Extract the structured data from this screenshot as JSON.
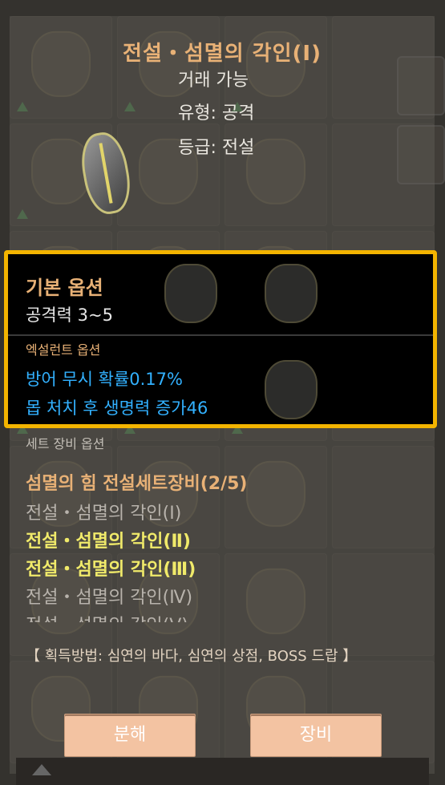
{
  "item": {
    "title": "전설・섬멸의 각인(Ⅰ)",
    "tradable": "거래 가능",
    "type": "유형: 공격",
    "grade": "등급: 전설"
  },
  "basic_options": {
    "title": "기본 옵션",
    "lines": [
      "공격력 3~5"
    ]
  },
  "excellent_options": {
    "title": "엑설런트 옵션",
    "lines": [
      "방어 무시 확률0.17%",
      "몹 처치 후 생명력 증가46"
    ]
  },
  "set_options": {
    "title": "세트 장비 옵션",
    "set_name": "섬멸의 힘 전설세트장비(2/5)",
    "items": [
      {
        "label": "전설・섬멸의 각인(Ⅰ)",
        "active": false
      },
      {
        "label": "전설・섬멸의 각인(Ⅱ)",
        "active": true
      },
      {
        "label": "전설・섬멸의 각인(Ⅲ)",
        "active": true
      },
      {
        "label": "전설・섬멸의 각인(Ⅳ)",
        "active": false
      },
      {
        "label": "전설・섬멸의 각인(Ⅴ)",
        "active": false
      }
    ]
  },
  "acquire_text": "【 획득방법: 심연의 바다, 심연의 상점, BOSS 드랍 】",
  "buttons": {
    "decompose": "분해",
    "equip": "장비"
  },
  "colors": {
    "title": "#e8b176",
    "excellent": "#32b1ff",
    "set_active": "#f0ea6a",
    "highlight_border": "#f3b400",
    "button": "#f3c3a2"
  }
}
